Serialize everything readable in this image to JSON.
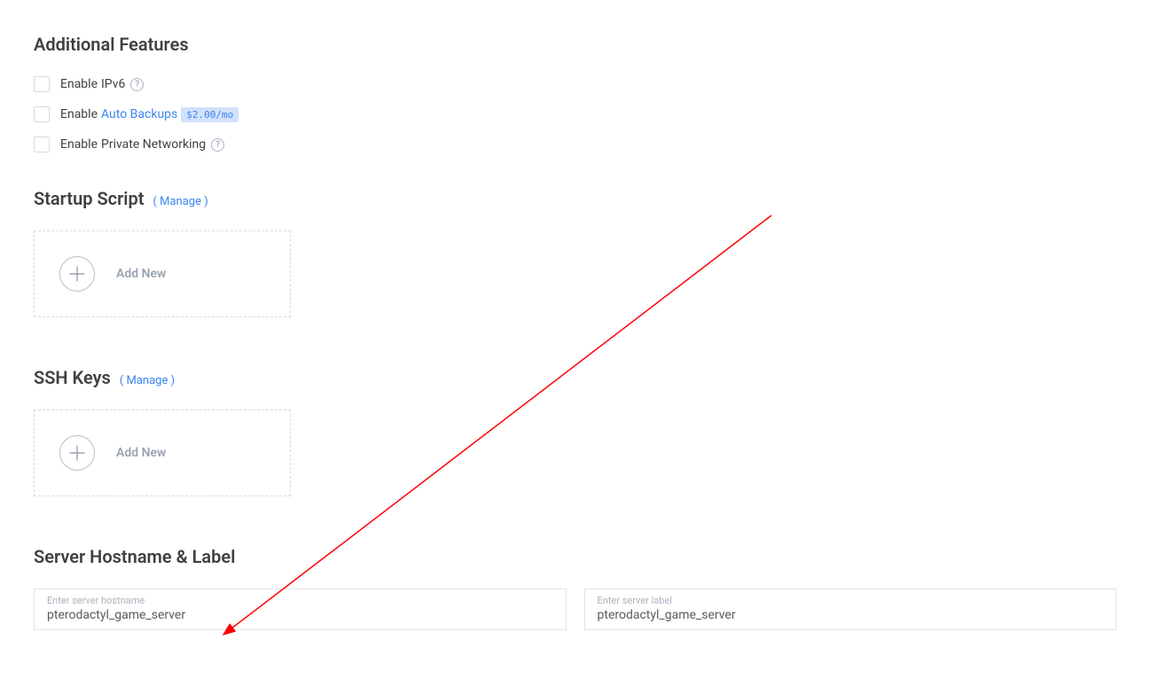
{
  "features": {
    "heading": "Additional Features",
    "items": [
      {
        "prefix": "Enable ",
        "linkedText": "",
        "suffix": "IPv6",
        "hasHelp": true,
        "hasBadge": false
      },
      {
        "prefix": "Enable ",
        "linkedText": "Auto Backups",
        "suffix": "",
        "hasHelp": false,
        "hasBadge": true,
        "badge": "$2.00/mo"
      },
      {
        "prefix": "Enable ",
        "linkedText": "",
        "suffix": "Private Networking",
        "hasHelp": true,
        "hasBadge": false
      }
    ]
  },
  "startup": {
    "heading": "Startup Script",
    "manage": "( Manage )",
    "add_label": "Add New"
  },
  "ssh": {
    "heading": "SSH Keys",
    "manage": "( Manage )",
    "add_label": "Add New"
  },
  "hostname": {
    "heading": "Server Hostname & Label",
    "hostname_mini": "Enter server hostname",
    "hostname_value": "pterodactyl_game_server",
    "label_mini": "Enter server label",
    "label_value": "pterodactyl_game_server"
  }
}
